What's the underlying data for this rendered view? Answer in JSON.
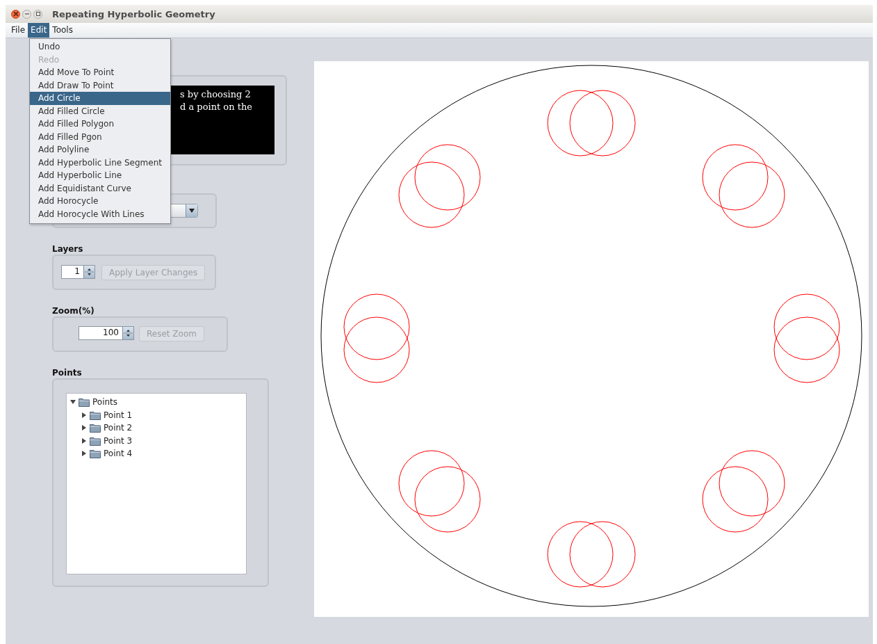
{
  "window": {
    "title": "Repeating Hyperbolic Geometry"
  },
  "menu_bar": [
    {
      "label": "File",
      "selected": false
    },
    {
      "label": "Edit",
      "selected": true
    },
    {
      "label": "Tools",
      "selected": false
    }
  ],
  "edit_menu": [
    {
      "label": "Undo",
      "disabled": false,
      "selected": false
    },
    {
      "label": "Redo",
      "disabled": true,
      "selected": false
    },
    {
      "label": "Add Move To Point",
      "disabled": false,
      "selected": false
    },
    {
      "label": "Add Draw To Point",
      "disabled": false,
      "selected": false
    },
    {
      "label": "Add Circle",
      "disabled": false,
      "selected": true
    },
    {
      "label": "Add Filled Circle",
      "disabled": false,
      "selected": false
    },
    {
      "label": "Add Filled Polygon",
      "disabled": false,
      "selected": false
    },
    {
      "label": "Add Filled Pgon",
      "disabled": false,
      "selected": false
    },
    {
      "label": "Add Polyline",
      "disabled": false,
      "selected": false
    },
    {
      "label": "Add Hyperbolic Line Segment",
      "disabled": false,
      "selected": false
    },
    {
      "label": "Add Hyperbolic Line",
      "disabled": false,
      "selected": false
    },
    {
      "label": "Add Equidistant Curve",
      "disabled": false,
      "selected": false
    },
    {
      "label": "Add Horocycle",
      "disabled": false,
      "selected": false
    },
    {
      "label": "Add Horocycle With Lines",
      "disabled": false,
      "selected": false
    }
  ],
  "instructions": {
    "lines": [
      "s by choosing 2",
      "d a point on the"
    ]
  },
  "layers": {
    "label": "Layers",
    "value": "1",
    "button": {
      "label": "Apply Layer Changes",
      "disabled": true
    }
  },
  "zoom": {
    "label": "Zoom(%)",
    "value": "100",
    "button": {
      "label": "Reset Zoom",
      "disabled": true
    }
  },
  "points": {
    "label": "Points",
    "tree": {
      "label": "Points",
      "expanded": true,
      "children": [
        {
          "label": "Point 1",
          "expanded": false
        },
        {
          "label": "Point 2",
          "expanded": false
        },
        {
          "label": "Point 3",
          "expanded": false
        },
        {
          "label": "Point 4",
          "expanded": false
        }
      ]
    }
  }
}
